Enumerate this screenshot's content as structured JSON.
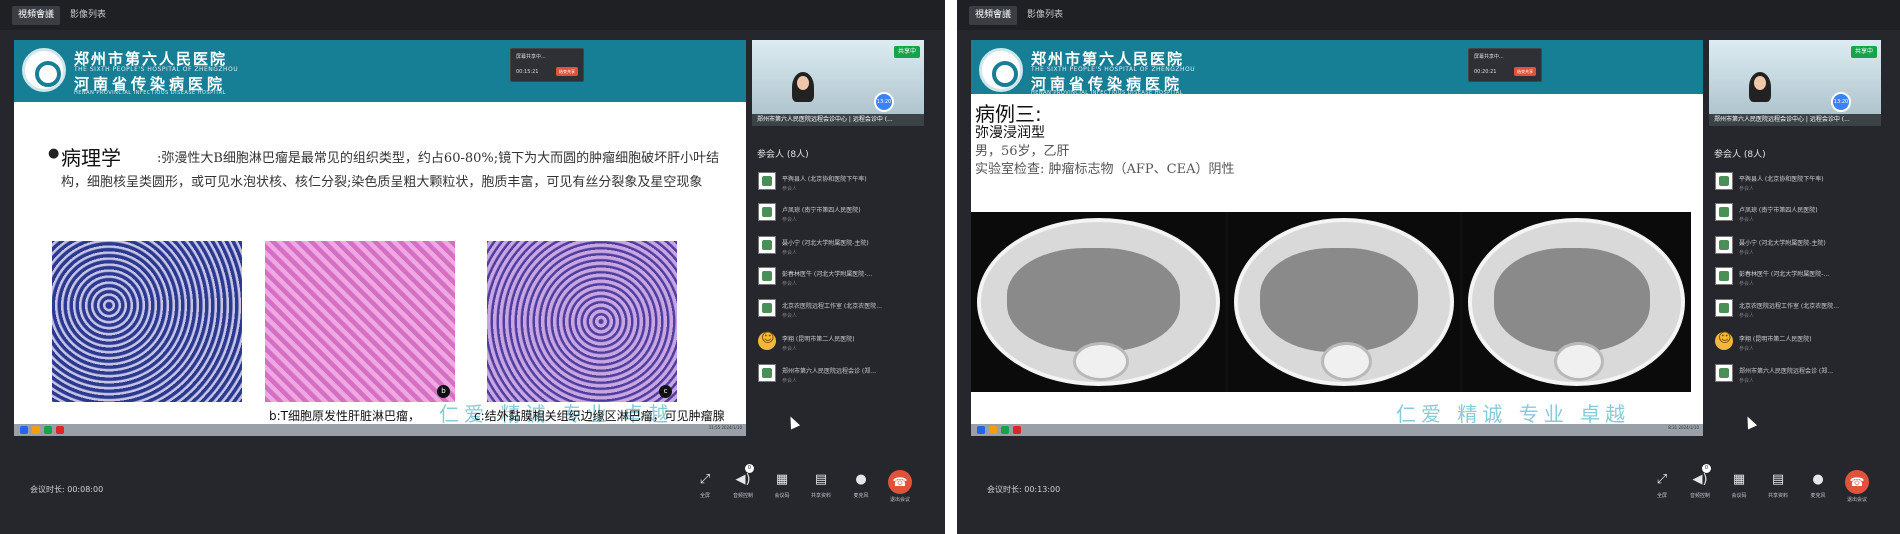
{
  "tabs": [
    "視頻會議",
    "影像列表"
  ],
  "left": {
    "slide": {
      "hospital_cn1": "郑州市第六人民医院",
      "hospital_en1": "THE SIXTH PEOPLE'S HOSPITAL OF ZHENGZHOU",
      "hospital_cn2": "河南省传染病医院",
      "hospital_en2": "HENAN PROVINCIAL INFECTIOUS DISEASE HOSPITAL",
      "popup": {
        "title": "屏幕共享中...",
        "time": "00:15:21",
        "button": "结束共享"
      },
      "bullet": "●",
      "title": "病理学",
      "body": ":弥漫性大B细胞淋巴瘤是最常见的组织类型，约占60-80%;镜下为大而圆的肿瘤细胞破坏肝小叶结构，细胞核呈类圆形，或可见水泡状核、核仁分裂;染色质呈粗大颗粒状，胞质丰富，可见有丝分裂象及星空现象",
      "image_labels": [
        "b",
        "c"
      ],
      "watermark": "仁爱 精诚 专业 卓越",
      "captions": [
        "b:T细胞原发性肝脏淋巴瘤，瘤细胞呈多形性，弥漫性生长",
        "c:结外黏膜相关组织边缘区淋巴瘤，可见肿瘤腺管"
      ],
      "taskbar_time": "11:55\n2024/1/10"
    },
    "video": {
      "share_tag": "共享中",
      "avatar_time": "13:20",
      "name": "郑州市第六人民医院远程会诊中心 | 远程会诊中 (..."
    },
    "participants_title": "参会人 (8人)",
    "participants": [
      {
        "name": "平舆县人 (北京协和医院下午率)",
        "role": "参会人"
      },
      {
        "name": "卢凤琼 (南宁市第四人民医院)",
        "role": "参会人"
      },
      {
        "name": "聂小宁 (河北大学附属医院-主院)",
        "role": "参会人"
      },
      {
        "name": "彭春林医牛 (河北大学附属医院-...",
        "role": "参会人"
      },
      {
        "name": "北京农医院远程工作室 (北京农医院...",
        "role": "参会人"
      },
      {
        "name": "李翔 (昆明市第二人民医院)",
        "role": "参会人"
      },
      {
        "name": "郑州市第六人民医院远程会诊 (郑...",
        "role": "参会人"
      }
    ],
    "duration": "会议时长: 00:08:00"
  },
  "right": {
    "slide": {
      "hospital_cn1": "郑州市第六人民医院",
      "hospital_en1": "THE SIXTH PEOPLE'S HOSPITAL OF ZHENGZHOU",
      "hospital_cn2": "河南省传染病医院",
      "hospital_en2": "HENAN PROVINCIAL INFECTIOUS DISEASE HOSPITAL",
      "popup": {
        "title": "屏幕共享中...",
        "time": "00:20:21",
        "button": "结束共享"
      },
      "title": "病例三:",
      "subtitle": "弥漫浸润型",
      "line1": "男，56岁，乙肝",
      "line2": "实验室检查: 肿瘤标志物（AFP、CEA）阴性",
      "watermark": "仁爱 精诚 专业 卓越",
      "taskbar_time": "8:31\n2024/1/10"
    },
    "video": {
      "share_tag": "共享中",
      "avatar_time": "13:20",
      "name": "郑州市第六人民医院远程会诊中心 | 远程会诊中 (..."
    },
    "participants_title": "参会人 (8人)",
    "participants": [
      {
        "name": "平舆县人 (北京协和医院下午率)",
        "role": "参会人"
      },
      {
        "name": "卢凤琼 (南宁市第四人民医院)",
        "role": "参会人"
      },
      {
        "name": "聂小宁 (河北大学附属医院-主院)",
        "role": "参会人"
      },
      {
        "name": "彭春林医牛 (河北大学附属医院-...",
        "role": "参会人"
      },
      {
        "name": "北京农医院远程工作室 (北京农医院...",
        "role": "参会人"
      },
      {
        "name": "李翔 (昆明市第二人民医院)",
        "role": "参会人"
      },
      {
        "name": "郑州市第六人民医院远程会诊 (郑...",
        "role": "参会人"
      }
    ],
    "duration": "会议时长: 00:13:00"
  },
  "controls": [
    {
      "label": "全屏",
      "icon": "fullscreen-icon"
    },
    {
      "label": "音频控制",
      "icon": "speaker-icon",
      "badge": "0"
    },
    {
      "label": "会议码",
      "icon": "qrcode-icon"
    },
    {
      "label": "共享资料",
      "icon": "document-icon"
    },
    {
      "label": "麦克风",
      "icon": "microphone-icon"
    },
    {
      "label": "退出会议",
      "icon": "hangup-icon"
    }
  ]
}
